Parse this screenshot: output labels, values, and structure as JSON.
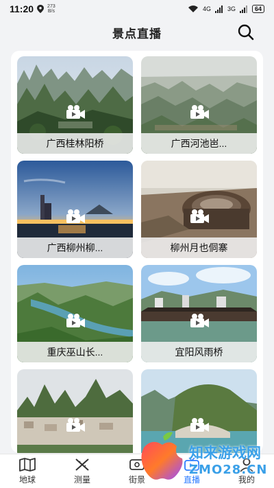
{
  "status_bar": {
    "time": "11:20",
    "net_speed_value": "273",
    "net_speed_unit": "B/s",
    "signal1": "4G",
    "signal2": "3G",
    "battery": "64"
  },
  "header": {
    "title": "景点直播"
  },
  "cards": [
    {
      "label": "广西桂林阳桥"
    },
    {
      "label": "广西河池岜..."
    },
    {
      "label": "广西柳州柳..."
    },
    {
      "label": "柳州月也侗寨"
    },
    {
      "label": "重庆巫山长..."
    },
    {
      "label": "宜阳风雨桥"
    },
    {
      "label": ""
    },
    {
      "label": ""
    }
  ],
  "bottom_nav": {
    "items": [
      {
        "label": "地球",
        "icon": "map-icon"
      },
      {
        "label": "测量",
        "icon": "ruler-pencil-icon"
      },
      {
        "label": "街景",
        "icon": "street-view-icon"
      },
      {
        "label": "直播",
        "icon": "live-icon",
        "active": true
      },
      {
        "label": "我的",
        "icon": "user-icon"
      }
    ]
  },
  "watermark": {
    "line1": "知来游戏网",
    "line2": "ZMO28.CN"
  },
  "colors": {
    "active": "#2b7cff",
    "background": "#f2f3f5"
  }
}
